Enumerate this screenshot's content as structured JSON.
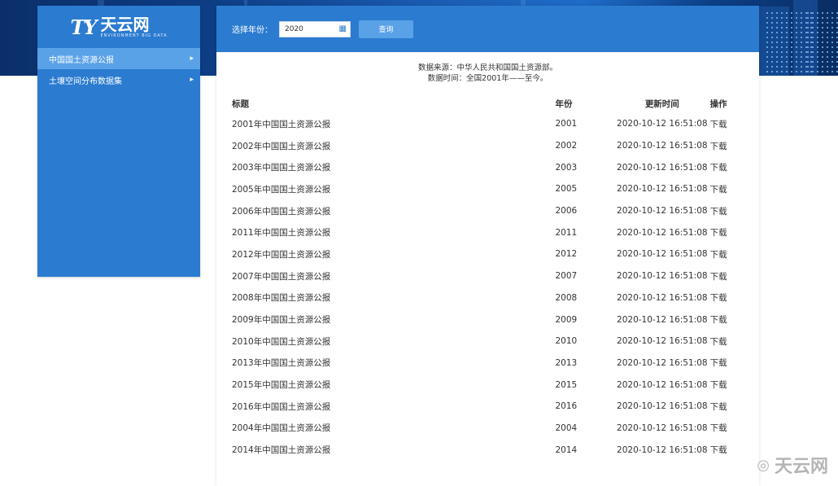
{
  "brand": {
    "logo_mark": "TY",
    "name": "天云网",
    "tagline": "ENVIRONMENT BIG DATA"
  },
  "sidebar": {
    "items": [
      {
        "label": "中国国土资源公报",
        "active": true
      },
      {
        "label": "土壤空间分布数据集",
        "active": false
      }
    ]
  },
  "toolbar": {
    "year_label": "选择年份：",
    "year_value": "2020",
    "query_label": "查询"
  },
  "info": {
    "source": "数据来源：中华人民共和国国土资源部。",
    "time": "数据时间：全国2001年——至今。"
  },
  "table": {
    "headers": [
      "标题",
      "年份",
      "更新时间",
      "操作"
    ],
    "rows": [
      {
        "title": "2001年中国国土资源公报",
        "year": "2001",
        "updated": "2020-10-12 16:51:08",
        "action": "下载"
      },
      {
        "title": "2002年中国国土资源公报",
        "year": "2002",
        "updated": "2020-10-12 16:51:08",
        "action": "下载"
      },
      {
        "title": "2003年中国国土资源公报",
        "year": "2003",
        "updated": "2020-10-12 16:51:08",
        "action": "下载"
      },
      {
        "title": "2005年中国国土资源公报",
        "year": "2005",
        "updated": "2020-10-12 16:51:08",
        "action": "下载"
      },
      {
        "title": "2006年中国国土资源公报",
        "year": "2006",
        "updated": "2020-10-12 16:51:08",
        "action": "下载"
      },
      {
        "title": "2011年中国国土资源公报",
        "year": "2011",
        "updated": "2020-10-12 16:51:08",
        "action": "下载"
      },
      {
        "title": "2012年中国国土资源公报",
        "year": "2012",
        "updated": "2020-10-12 16:51:08",
        "action": "下载"
      },
      {
        "title": "2007年中国国土资源公报",
        "year": "2007",
        "updated": "2020-10-12 16:51:08",
        "action": "下载"
      },
      {
        "title": "2008年中国国土资源公报",
        "year": "2008",
        "updated": "2020-10-12 16:51:08",
        "action": "下载"
      },
      {
        "title": "2009年中国国土资源公报",
        "year": "2009",
        "updated": "2020-10-12 16:51:08",
        "action": "下载"
      },
      {
        "title": "2010年中国国土资源公报",
        "year": "2010",
        "updated": "2020-10-12 16:51:08",
        "action": "下载"
      },
      {
        "title": "2013年中国国土资源公报",
        "year": "2013",
        "updated": "2020-10-12 16:51:08",
        "action": "下载"
      },
      {
        "title": "2015年中国国土资源公报",
        "year": "2015",
        "updated": "2020-10-12 16:51:08",
        "action": "下载"
      },
      {
        "title": "2016年中国国土资源公报",
        "year": "2016",
        "updated": "2020-10-12 16:51:08",
        "action": "下载"
      },
      {
        "title": "2004年中国国土资源公报",
        "year": "2004",
        "updated": "2020-10-12 16:51:08",
        "action": "下载"
      },
      {
        "title": "2014年中国国土资源公报",
        "year": "2014",
        "updated": "2020-10-12 16:51:08",
        "action": "下载"
      }
    ]
  },
  "watermark": {
    "icon": "weibo-icon",
    "text": "天云网"
  },
  "colors": {
    "primary": "#2b7bd0",
    "active": "#5aa2e8",
    "hero_dark": "#0b2f6a"
  }
}
